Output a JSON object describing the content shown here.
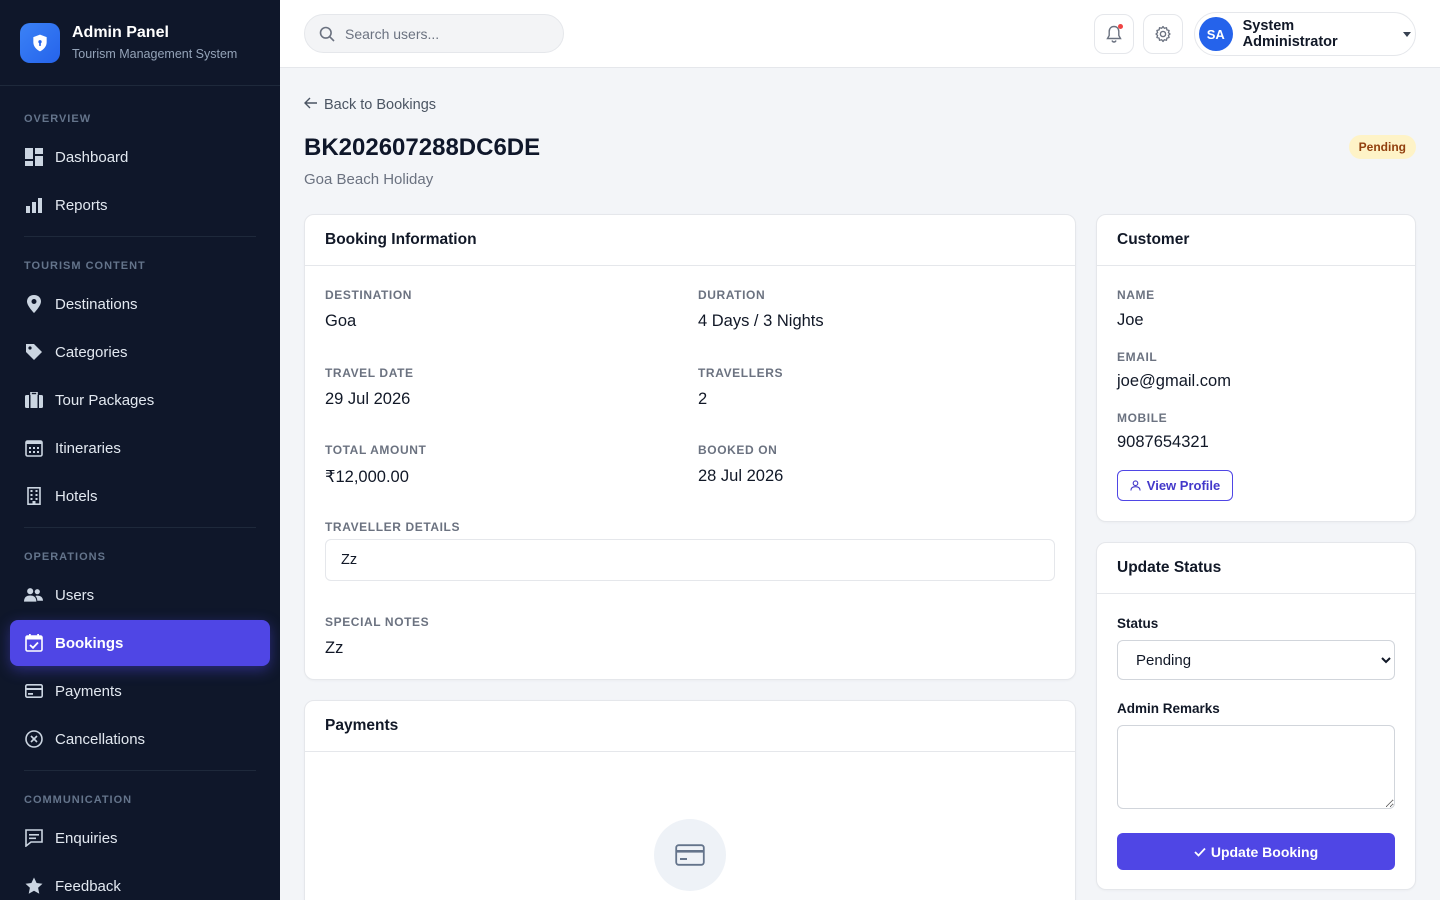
{
  "brand": {
    "title": "Admin Panel",
    "subtitle": "Tourism Management System"
  },
  "sidebar": {
    "sections": [
      {
        "label": "OVERVIEW",
        "items": [
          {
            "label": "Dashboard",
            "icon": "dashboard-icon"
          },
          {
            "label": "Reports",
            "icon": "bar-chart-icon"
          }
        ]
      },
      {
        "label": "TOURISM CONTENT",
        "items": [
          {
            "label": "Destinations",
            "icon": "map-pin-icon"
          },
          {
            "label": "Categories",
            "icon": "tag-icon"
          },
          {
            "label": "Tour Packages",
            "icon": "briefcase-icon"
          },
          {
            "label": "Itineraries",
            "icon": "calendar-grid-icon"
          },
          {
            "label": "Hotels",
            "icon": "building-icon"
          }
        ]
      },
      {
        "label": "OPERATIONS",
        "items": [
          {
            "label": "Users",
            "icon": "users-icon"
          },
          {
            "label": "Bookings",
            "icon": "calendar-check-icon",
            "active": true
          },
          {
            "label": "Payments",
            "icon": "payment-icon"
          },
          {
            "label": "Cancellations",
            "icon": "x-circle-icon"
          }
        ]
      },
      {
        "label": "COMMUNICATION",
        "items": [
          {
            "label": "Enquiries",
            "icon": "message-icon"
          },
          {
            "label": "Feedback",
            "icon": "star-icon"
          }
        ]
      }
    ]
  },
  "topbar": {
    "search_placeholder": "Search users...",
    "user_initials": "SA",
    "user_name": "System Administrator"
  },
  "page": {
    "back_label": "Back to Bookings",
    "booking_id": "BK202607288DC6DE",
    "package_name": "Goa Beach Holiday",
    "status_badge": "Pending"
  },
  "booking_info": {
    "title": "Booking Information",
    "destination_label": "Destination",
    "destination": "Goa",
    "duration_label": "Duration",
    "duration": "4 Days / 3 Nights",
    "travel_date_label": "Travel Date",
    "travel_date": "29 Jul 2026",
    "travellers_label": "Travellers",
    "travellers": "2",
    "total_amount_label": "Total Amount",
    "total_amount": "₹12,000.00",
    "booked_on_label": "Booked On",
    "booked_on": "28 Jul 2026",
    "traveller_details_label": "Traveller Details",
    "traveller_details": "Zz",
    "special_notes_label": "Special Notes",
    "special_notes": "Zz"
  },
  "payments": {
    "title": "Payments"
  },
  "customer": {
    "title": "Customer",
    "name_label": "Name",
    "name": "Joe",
    "email_label": "Email",
    "email": "joe@gmail.com",
    "mobile_label": "Mobile",
    "mobile": "9087654321",
    "view_profile_label": "View Profile"
  },
  "update_status": {
    "title": "Update Status",
    "status_label": "Status",
    "status_value": "Pending",
    "remarks_label": "Admin Remarks",
    "button_label": "Update Booking"
  }
}
